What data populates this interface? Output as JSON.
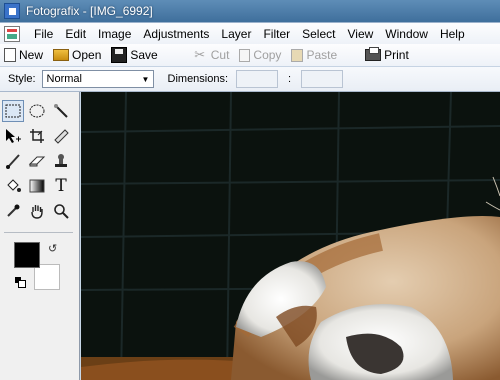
{
  "window": {
    "title": "Fotografix - [IMG_6992]"
  },
  "menu": [
    "File",
    "Edit",
    "Image",
    "Adjustments",
    "Layer",
    "Filter",
    "Select",
    "View",
    "Window",
    "Help"
  ],
  "toolbar": {
    "new": "New",
    "open": "Open",
    "save": "Save",
    "cut": "Cut",
    "copy": "Copy",
    "paste": "Paste",
    "print": "Print"
  },
  "options": {
    "style_label": "Style:",
    "style_value": "Normal",
    "dimensions_label": "Dimensions:",
    "dim_separator": ":"
  },
  "tools": [
    "rect-select-icon",
    "ellipse-select-icon",
    "magic-wand-icon",
    "move-icon",
    "crop-icon",
    "ruler-icon",
    "brush-icon",
    "eraser-icon",
    "stamp-icon",
    "fill-icon",
    "gradient-icon",
    "text-icon",
    "eyedropper-icon",
    "hand-icon",
    "zoom-icon"
  ],
  "colors": {
    "foreground": "#000000",
    "background": "#ffffff"
  },
  "canvas": {
    "image": "photo of a red panda behind a wire fence"
  }
}
